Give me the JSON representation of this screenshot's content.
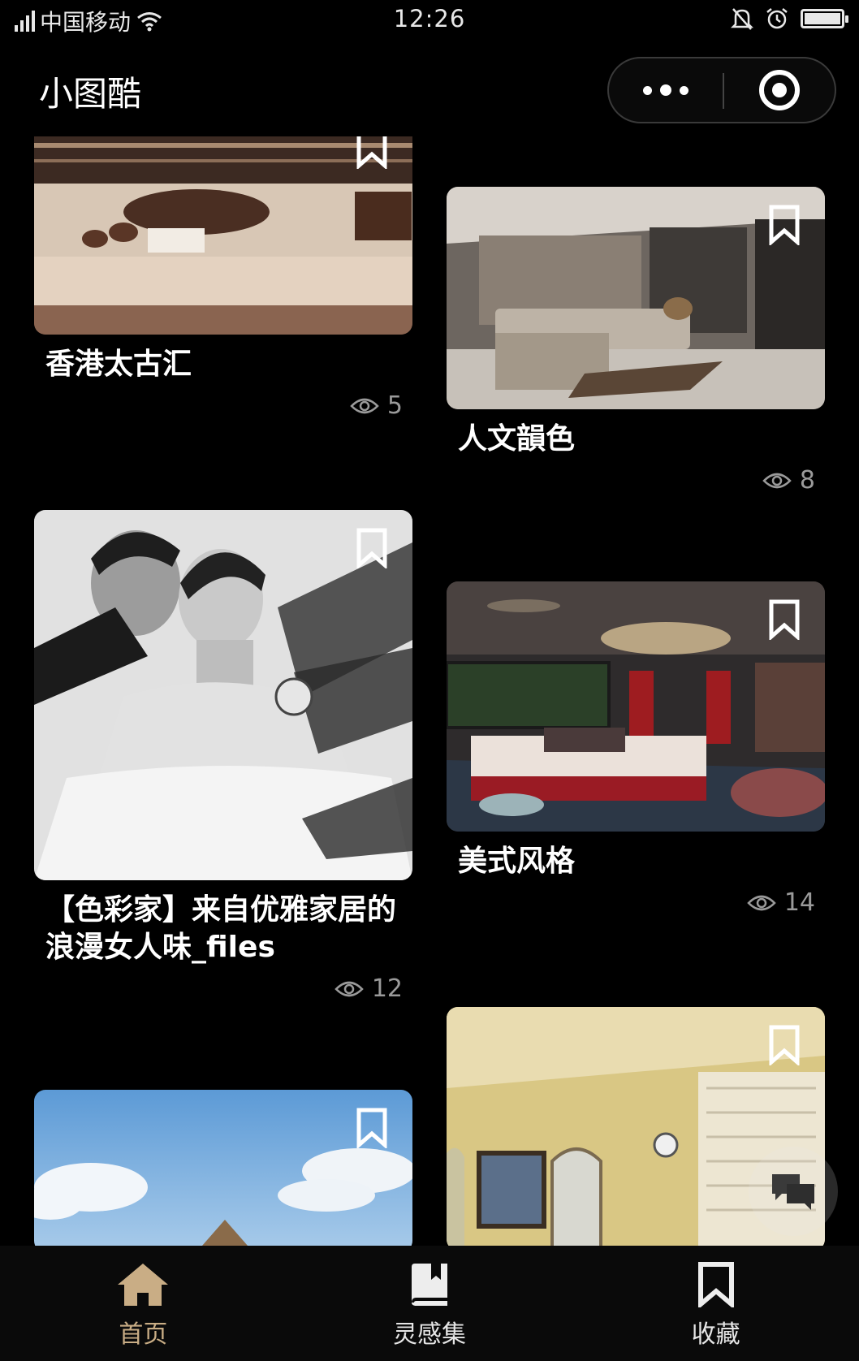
{
  "status_bar": {
    "carrier": "中国移动",
    "time": "12:26",
    "battery_percent": 100
  },
  "header": {
    "title": "小图酷",
    "more_icon": "more-dots-icon",
    "close_icon": "target-circle-icon"
  },
  "feed": {
    "cards": [
      {
        "title": "香港太古汇",
        "views": "5",
        "image": "chocolate-display-photo"
      },
      {
        "title": "人文韻色",
        "views": "8",
        "image": "living-room-photo"
      },
      {
        "title": "【色彩家】来自优雅家居的浪漫女人味_files",
        "views": "12",
        "image": "vintage-couple-photo"
      },
      {
        "title": "美式风格",
        "views": "14",
        "image": "american-style-room-photo"
      },
      {
        "title": "",
        "views": "",
        "image": "sky-photo"
      },
      {
        "title": "",
        "views": "",
        "image": "yellow-room-photo"
      }
    ]
  },
  "tab_bar": {
    "tabs": [
      {
        "label": "首页",
        "icon": "home-icon",
        "active": true
      },
      {
        "label": "灵感集",
        "icon": "book-icon",
        "active": false
      },
      {
        "label": "收藏",
        "icon": "bookmark-icon",
        "active": false
      }
    ],
    "active_color": "#c9ad85"
  },
  "fab": {
    "icon": "chat-bubbles-icon"
  }
}
